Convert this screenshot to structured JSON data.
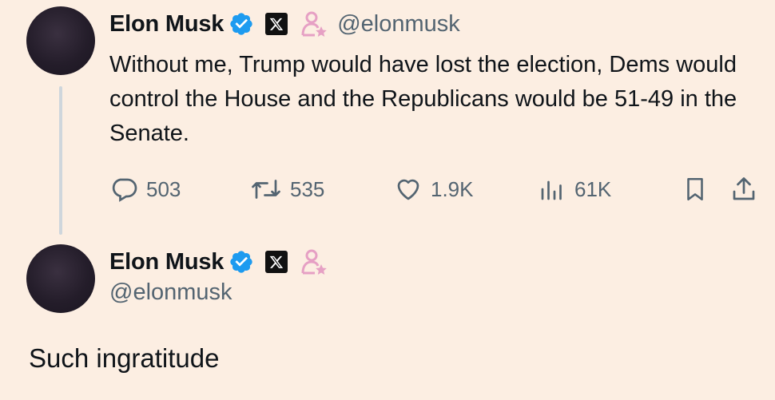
{
  "tweet1": {
    "name": "Elon Musk",
    "handle": "@elonmusk",
    "text": "Without me, Trump would have lost the election, Dems would control the House and the Republicans would be 51-49 in the Senate.",
    "icons": [
      "verified-badge-icon",
      "x-logo-icon",
      "affiliate-person-icon"
    ],
    "actions": {
      "replies": "503",
      "reposts": "535",
      "likes": "1.9K",
      "views": "61K"
    }
  },
  "tweet2": {
    "name": "Elon Musk",
    "handle": "@elonmusk",
    "text": "Such ingratitude",
    "icons": [
      "verified-badge-icon",
      "x-logo-icon",
      "affiliate-person-icon"
    ]
  },
  "colors": {
    "background": "#fceee2",
    "verified": "#1d9bf0",
    "muted": "#536471",
    "affiliate": "#e6a0c4"
  }
}
